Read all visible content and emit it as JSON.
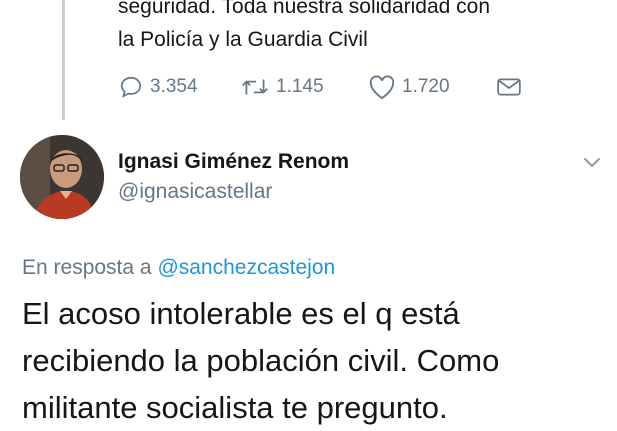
{
  "previous_tweet": {
    "text_lines": [
      "seguridad. Toda nuestra solidaridad con",
      "la Policía y la Guardia Civil"
    ],
    "actions": {
      "reply_count": "3.354",
      "retweet_count": "1.145",
      "like_count": "1.720",
      "reply_icon": "reply-icon",
      "retweet_icon": "retweet-icon",
      "like_icon": "heart-icon",
      "dm_icon": "envelope-icon"
    }
  },
  "tweet": {
    "author": {
      "name": "Ignasi Giménez Renom",
      "handle": "@ignasicastellar"
    },
    "reply_prefix": "En resposta a",
    "reply_mention": "@sanchezcastejon",
    "text_lines": [
      "El acoso intolerable es el q está",
      "recibiendo la población civil. Como",
      "militante socialista te pregunto."
    ]
  },
  "colors": {
    "text": "#14171a",
    "secondary": "#657786",
    "link": "#1b95e0",
    "thread_line": "#c4cfd6"
  }
}
